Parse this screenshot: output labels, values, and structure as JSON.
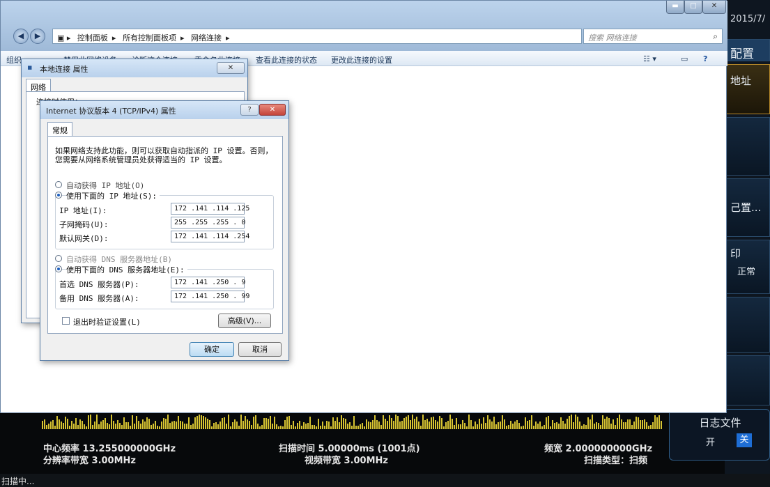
{
  "instrument": {
    "date": "2015/7/",
    "softkeys": {
      "config_header": "配置",
      "address": "地址",
      "config_ellipsis": "己置...",
      "print_partial": "印",
      "print_status": "正常"
    },
    "log": {
      "title": "日志文件",
      "on": "开",
      "off": "关"
    },
    "measurements": {
      "center_freq": "中心频率 13.255000000GHz",
      "rbw": "分辨率带宽 3.00MHz",
      "sweep_time": "扫描时间 5.00000ms (1001点)",
      "vbw": "视频带宽 3.00MHz",
      "span": "频宽 2.000000000GHz",
      "sweep_type": "扫描类型：扫频"
    },
    "status": "扫描中..."
  },
  "explorer": {
    "breadcrumb": [
      "控制面板",
      "所有控制面板项",
      "网络连接"
    ],
    "search_placeholder": "搜索 网络连接",
    "commands": {
      "organize": "组织 ▾",
      "disable": "禁用此网络设备",
      "diagnose": "诊断这个连接",
      "rename": "重命名此连接",
      "view_status": "查看此连接的状态",
      "change_settings": "更改此连接的设置"
    }
  },
  "local_props": {
    "title": "本地连接 属性",
    "tab": "网络",
    "connect_using": "连接时使用："
  },
  "ipv4": {
    "title": "Internet 协议版本 4 (TCP/IPv4) 属性",
    "tab": "常规",
    "description_line1": "如果网络支持此功能，则可以获取自动指派的 IP 设置。否则，",
    "description_line2": "您需要从网络系统管理员处获得适当的 IP 设置。",
    "auto_ip": "自动获得 IP 地址(O)",
    "manual_ip": "使用下面的 IP 地址(S):",
    "ip_label": "IP 地址(I):",
    "ip_value": "172 .141 .114 .125",
    "mask_label": "子网掩码(U):",
    "mask_value": "255 .255 .255 . 0",
    "gateway_label": "默认网关(D):",
    "gateway_value": "172 .141 .114 .254",
    "auto_dns": "自动获得 DNS 服务器地址(B)",
    "manual_dns": "使用下面的 DNS 服务器地址(E):",
    "dns1_label": "首选 DNS 服务器(P):",
    "dns1_value": "172 .141 .250 . 9",
    "dns2_label": "备用 DNS 服务器(A):",
    "dns2_value": "172 .141 .250 . 99",
    "validate": "退出时验证设置(L)",
    "advanced": "高级(V)...",
    "ok": "确定",
    "cancel": "取消"
  },
  "colors": {
    "spectrum": "#d7c432",
    "instrument_bg": "#07090b",
    "log_off": "#1e6ed6"
  }
}
